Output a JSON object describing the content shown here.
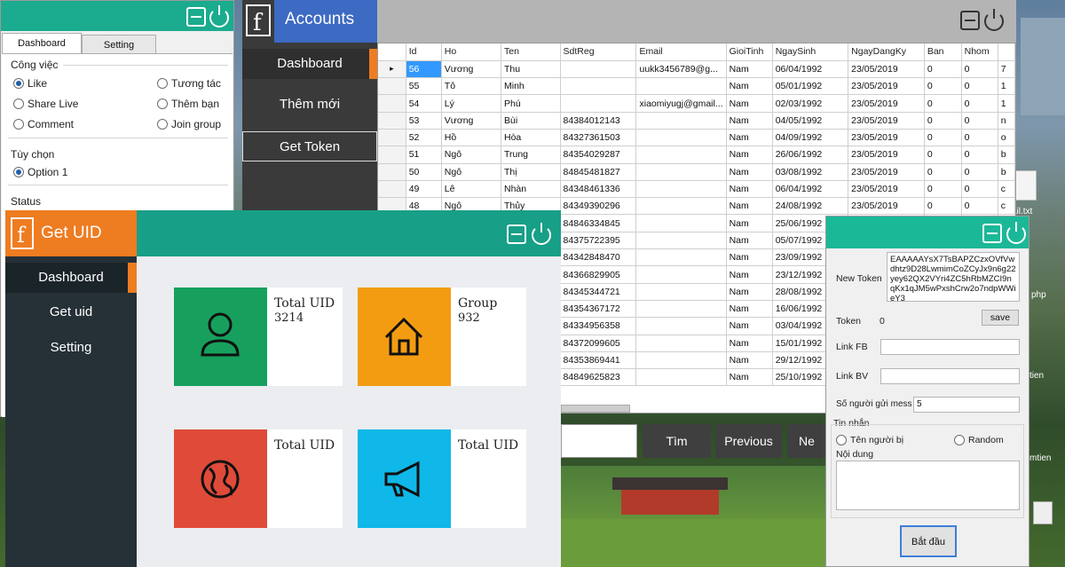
{
  "options_window": {
    "tab_dashboard": "Dashboard",
    "tab_setting": "Setting",
    "cong_viec_label": "Công việc",
    "options": [
      "Like",
      "Tương tác",
      "Share Live",
      "Thêm bạn",
      "Comment",
      "Join group"
    ],
    "tuy_chon_label": "Tùy chọn",
    "option1": "Option 1",
    "status_label": "Status"
  },
  "accounts_window": {
    "title": "Accounts",
    "logo": "f",
    "nav": [
      "Dashboard",
      "Thêm mới",
      "Get Token"
    ],
    "columns": [
      "Id",
      "Ho",
      "Ten",
      "SdtReg",
      "Email",
      "GioiTinh",
      "NgaySinh",
      "NgayDangKy",
      "Ban",
      "Nhom"
    ],
    "rows": [
      [
        "56",
        "Vương",
        "Thu",
        "",
        "uukk3456789@g...",
        "Nam",
        "06/04/1992",
        "23/05/2019",
        "0",
        "0",
        "7"
      ],
      [
        "55",
        "Tô",
        "Minh",
        "",
        "",
        "Nam",
        "05/01/1992",
        "23/05/2019",
        "0",
        "0",
        "1"
      ],
      [
        "54",
        "Lý",
        "Phú",
        "",
        "xiaomiyugj@gmail...",
        "Nam",
        "02/03/1992",
        "23/05/2019",
        "0",
        "0",
        "1"
      ],
      [
        "53",
        "Vương",
        "Bùi",
        "84384012143",
        "",
        "Nam",
        "04/05/1992",
        "23/05/2019",
        "0",
        "0",
        "n"
      ],
      [
        "52",
        "Hồ",
        "Hòa",
        "84327361503",
        "",
        "Nam",
        "04/09/1992",
        "23/05/2019",
        "0",
        "0",
        "o"
      ],
      [
        "51",
        "Ngô",
        "Trung",
        "84354029287",
        "",
        "Nam",
        "26/06/1992",
        "23/05/2019",
        "0",
        "0",
        "b"
      ],
      [
        "50",
        "Ngô",
        "Thị",
        "84845481827",
        "",
        "Nam",
        "03/08/1992",
        "23/05/2019",
        "0",
        "0",
        "b"
      ],
      [
        "49",
        "Lê",
        "Nhàn",
        "84348461336",
        "",
        "Nam",
        "06/04/1992",
        "23/05/2019",
        "0",
        "0",
        "c"
      ],
      [
        "48",
        "Ngô",
        "Thủy",
        "84349390296",
        "",
        "Nam",
        "24/08/1992",
        "23/05/2019",
        "0",
        "0",
        "c"
      ],
      [
        "",
        "",
        "",
        "84846334845",
        "",
        "Nam",
        "25/06/1992",
        "",
        "",
        "",
        ""
      ],
      [
        "",
        "",
        "",
        "84375722395",
        "",
        "Nam",
        "05/07/1992",
        "",
        "",
        "",
        ""
      ],
      [
        "",
        "",
        "",
        "84342848470",
        "",
        "Nam",
        "23/09/1992",
        "",
        "",
        "",
        ""
      ],
      [
        "",
        "",
        "",
        "84366829905",
        "",
        "Nam",
        "23/12/1992",
        "",
        "",
        "",
        ""
      ],
      [
        "",
        "",
        "",
        "84345344721",
        "",
        "Nam",
        "28/08/1992",
        "",
        "",
        "",
        ""
      ],
      [
        "",
        "",
        "",
        "84354367172",
        "",
        "Nam",
        "16/06/1992",
        "",
        "",
        "",
        ""
      ],
      [
        "",
        "",
        "",
        "84334956358",
        "",
        "Nam",
        "03/04/1992",
        "",
        "",
        "",
        ""
      ],
      [
        "",
        "",
        "",
        "84372099605",
        "",
        "Nam",
        "15/01/1992",
        "",
        "",
        "",
        ""
      ],
      [
        "",
        "",
        "",
        "84353869441",
        "",
        "Nam",
        "29/12/1992",
        "",
        "",
        "",
        ""
      ],
      [
        "",
        "",
        "",
        "84849625823",
        "",
        "Nam",
        "25/10/1992",
        "",
        "",
        "",
        ""
      ]
    ],
    "btn_tim": "Tìm",
    "btn_previous": "Previous",
    "btn_next": "Ne"
  },
  "getuid_window": {
    "logo": "f",
    "title": "Get UID",
    "nav": [
      "Dashboard",
      "Get uid",
      "Setting"
    ],
    "tiles": [
      {
        "label": "Total UID",
        "value": "3214",
        "color": "#17a05d",
        "icon": "user-icon"
      },
      {
        "label": "Group",
        "value": "932",
        "color": "#f39c12",
        "icon": "home-icon"
      },
      {
        "label": "Total UID",
        "value": "",
        "color": "#e04b39",
        "icon": "globe-icon"
      },
      {
        "label": "Total UID",
        "value": "",
        "color": "#0fb8e8",
        "icon": "megaphone-icon"
      }
    ]
  },
  "token_window": {
    "new_token_label": "New Token",
    "new_token_value": "EAAAAAYsX7TsBAPZCzxOVfVwdhtz9D28LwmimCoZCyJx9n6g22yey62QX2VYri4ZC5hRbMZCI9nqKx1qJM5wPxshCrw2o7ndpWWieY3",
    "token_label": "Token",
    "token_value": "0",
    "save": "save",
    "link_fb": "Link FB",
    "link_bv": "Link BV",
    "so_nguoi_label": "Số người gửi mess",
    "so_nguoi_value": "5",
    "tin_nhan": "Tin nhắn",
    "ten_nguoi_bi": "Tên người bị",
    "random": "Random",
    "noi_dung": "Nội dung",
    "bat_dau": "Bắt đầu"
  },
  "desktop": {
    "file1": "ail.txt",
    "file2": "php",
    "file3": "tien",
    "file4": "mtien"
  }
}
